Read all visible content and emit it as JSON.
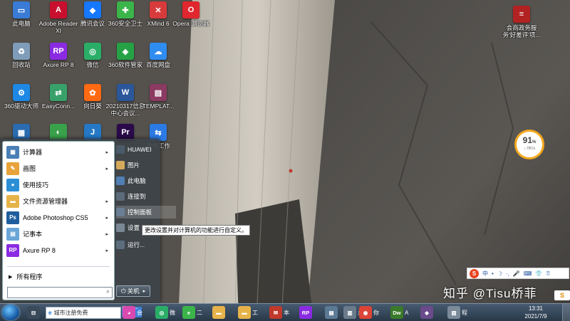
{
  "desktop": {
    "icons": [
      {
        "label": "此电脑",
        "icon": "computer-icon",
        "color": "#3a7bd5",
        "glyph": "▭"
      },
      {
        "label": "Adobe Reader XI",
        "icon": "adobe-reader-icon",
        "color": "#c8102e",
        "glyph": "A"
      },
      {
        "label": "腾讯会议",
        "icon": "tencent-meeting-icon",
        "color": "#1677ff",
        "glyph": "◆"
      },
      {
        "label": "360安全卫士",
        "icon": "360-security-icon",
        "color": "#3bb54a",
        "glyph": "✚"
      },
      {
        "label": "XMind 6",
        "icon": "xmind-icon",
        "color": "#d83b3b",
        "glyph": "✕"
      },
      {
        "label": "Opera 浏览器",
        "icon": "opera-icon",
        "color": "#e0262e",
        "glyph": "O"
      },
      {
        "label": "回收站",
        "icon": "recycle-bin-icon",
        "color": "#7f9db9",
        "glyph": "♻"
      },
      {
        "label": "Axure RP 8",
        "icon": "axure-icon",
        "color": "#8a2be2",
        "glyph": "RP"
      },
      {
        "label": "微信",
        "icon": "wechat-icon",
        "color": "#2aae67",
        "glyph": "◎"
      },
      {
        "label": "360软件管家",
        "icon": "360-software-icon",
        "color": "#25a245",
        "glyph": "◈"
      },
      {
        "label": "百度网盘",
        "icon": "baidu-netdisk-icon",
        "color": "#2f8cf0",
        "glyph": "☁"
      },
      {
        "label": "360驱动大师",
        "icon": "360-driver-icon",
        "color": "#1e88e5",
        "glyph": "⚙"
      },
      {
        "label": "EasyConn...",
        "icon": "easyconnect-icon",
        "color": "#38a169",
        "glyph": "⇄"
      },
      {
        "label": "向日葵",
        "icon": "sunflower-icon",
        "color": "#ff6a13",
        "glyph": "✿"
      },
      {
        "label": "20210317信息中心会议...",
        "icon": "word-doc-icon",
        "color": "#2b579a",
        "glyph": "W"
      },
      {
        "label": "TEMPLAT...",
        "icon": "winrar-icon",
        "color": "#8b3a62",
        "glyph": "▤"
      },
      {
        "label": "HUAWEI",
        "icon": "huawei-icon",
        "color": "#2b6cb0",
        "glyph": "▦"
      },
      {
        "label": "",
        "icon": "green-app-icon",
        "color": "#3aa14b",
        "glyph": "◐"
      },
      {
        "label": "",
        "icon": "blue-app-icon",
        "color": "#2578c5",
        "glyph": "J"
      },
      {
        "label": "",
        "icon": "premiere-icon",
        "color": "#2a0a4a",
        "glyph": "Pr"
      },
      {
        "label": "政协工作",
        "icon": "folder-doc-icon",
        "color": "#2c7be5",
        "glyph": "⇆"
      },
      {
        "label": "会商政务服务'好差评'项...",
        "icon": "document-icon",
        "color": "#b22222",
        "glyph": "≡"
      }
    ],
    "widget_speed": {
      "percent": "91",
      "unit": "%",
      "rate": "↓ 0K/s",
      "ring_color": "#f3a81f"
    },
    "watermark": "知乎 @Tisu桥菲",
    "badge": "S"
  },
  "start_menu": {
    "programs": [
      {
        "label": "计算器",
        "icon": "calculator-icon",
        "color": "#4a7fb5",
        "glyph": "▦",
        "has_submenu": true
      },
      {
        "label": "画图",
        "icon": "paint-icon",
        "color": "#e8a33a",
        "glyph": "✎",
        "has_submenu": true
      },
      {
        "label": "使用技巧",
        "icon": "tips-icon",
        "color": "#2c8fd6",
        "glyph": "●",
        "has_submenu": false
      },
      {
        "label": "文件资源管理器",
        "icon": "file-explorer-icon",
        "color": "#e6b34a",
        "glyph": "▬",
        "has_submenu": true
      },
      {
        "label": "Adobe Photoshop CS5",
        "icon": "photoshop-icon",
        "color": "#1f5e9e",
        "glyph": "Ps",
        "has_submenu": true
      },
      {
        "label": "记事本",
        "icon": "notepad-icon",
        "color": "#6aa6d8",
        "glyph": "▤",
        "has_submenu": true
      },
      {
        "label": "Axure RP 8",
        "icon": "axure-icon",
        "color": "#8a2be2",
        "glyph": "RP",
        "has_submenu": true
      }
    ],
    "all_programs": "所有程序",
    "search_placeholder": "",
    "right_items": [
      {
        "label": "HUAWEI",
        "icon": "huawei-folder-icon",
        "color": "#4b5a68"
      },
      {
        "label": "图片",
        "icon": "pictures-icon",
        "color": "#d5a95a"
      },
      {
        "label": "此电脑",
        "icon": "computer-icon",
        "color": "#4f7fb3"
      },
      {
        "label": "连接到",
        "icon": "connect-icon",
        "color": "#5b6b7a"
      },
      {
        "label": "控制面板",
        "icon": "control-panel-icon",
        "color": "#6a7f95"
      },
      {
        "label": "设置",
        "icon": "settings-icon",
        "color": "#7a8896"
      },
      {
        "label": "运行...",
        "icon": "run-icon",
        "color": "#5c6d7e"
      }
    ],
    "shutdown_label": "关机",
    "tooltip": "更改设置并对计算机的功能进行自定义。"
  },
  "taskbar": {
    "search_value": "城市注册免费",
    "search_button": "搜索一下",
    "items": [
      {
        "label": "",
        "icon": "task-view-icon",
        "color": "#3a4a5a",
        "glyph": "⊟"
      },
      {
        "label": "会",
        "icon": "chrome-colorful-icon",
        "color": "#d94ab0",
        "glyph": "◕"
      },
      {
        "label": "微",
        "icon": "wechat-icon",
        "color": "#2aae67",
        "glyph": "◎"
      },
      {
        "label": "二",
        "icon": "360-browser-icon",
        "color": "#3bb54a",
        "glyph": "e"
      },
      {
        "label": "",
        "icon": "folder-icon",
        "color": "#e6b34a",
        "glyph": "▬"
      },
      {
        "label": "工",
        "icon": "folder-icon",
        "color": "#e6b34a",
        "glyph": "▬"
      },
      {
        "label": "本",
        "icon": "mail-icon",
        "color": "#c0392b",
        "glyph": "✉"
      },
      {
        "label": "",
        "icon": "axure-icon",
        "color": "#8a2be2",
        "glyph": "RP"
      },
      {
        "label": "",
        "icon": "document-icon",
        "color": "#5d7a95",
        "glyph": "▤"
      },
      {
        "label": "总",
        "icon": "file-icon",
        "color": "#6b7b8b",
        "glyph": "▥"
      },
      {
        "label": "你",
        "icon": "chrome-icon",
        "color": "#db4437",
        "glyph": "◉"
      },
      {
        "label": "A",
        "icon": "dreamweaver-icon",
        "color": "#3b7a2a",
        "glyph": "Dw"
      },
      {
        "label": "",
        "icon": "app-icon",
        "color": "#6a4a8a",
        "glyph": "◆"
      },
      {
        "label": "程",
        "icon": "photo-icon",
        "color": "#7a8a99",
        "glyph": "▧"
      }
    ],
    "clock_time": "13:31",
    "clock_date": "2021/7/9"
  },
  "ime_bar": {
    "logo": "S",
    "items": [
      "中",
      "•",
      "☽",
      "·,",
      "🎤",
      "⌨",
      "👕",
      "⠿"
    ]
  },
  "colors": {
    "taskbar": "#34475a",
    "accent": "#1a5fa8"
  }
}
